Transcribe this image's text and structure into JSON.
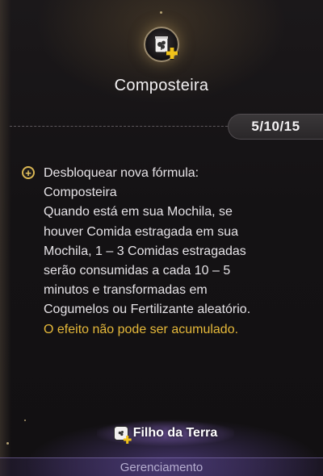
{
  "item": {
    "icon": "compost-bag-icon",
    "badge_icon": "plus-icon",
    "title": "Composteira"
  },
  "level": {
    "text": "5/10/15"
  },
  "description": {
    "bullet_icon": "plus-circle-icon",
    "lines": [
      "Desbloquear nova fórmula:",
      "Composteira",
      "Quando está em sua Mochila, se",
      "houver Comida estragada em sua",
      "Mochila, 1 – 3 Comidas estragadas",
      "serão consumidas a cada 10 – 5",
      "minutos e transformadas em",
      "Cogumelos ou Fertilizante aleatório."
    ],
    "warning": "O efeito não pode ser acumulado."
  },
  "skill": {
    "icon": "compost-bag-icon",
    "label": "Filho da Terra"
  },
  "footer": {
    "label": "Gerenciamento"
  },
  "colors": {
    "accent_gold": "#e6b93a",
    "skill_glow": "#a078e6",
    "background": "#141214"
  }
}
